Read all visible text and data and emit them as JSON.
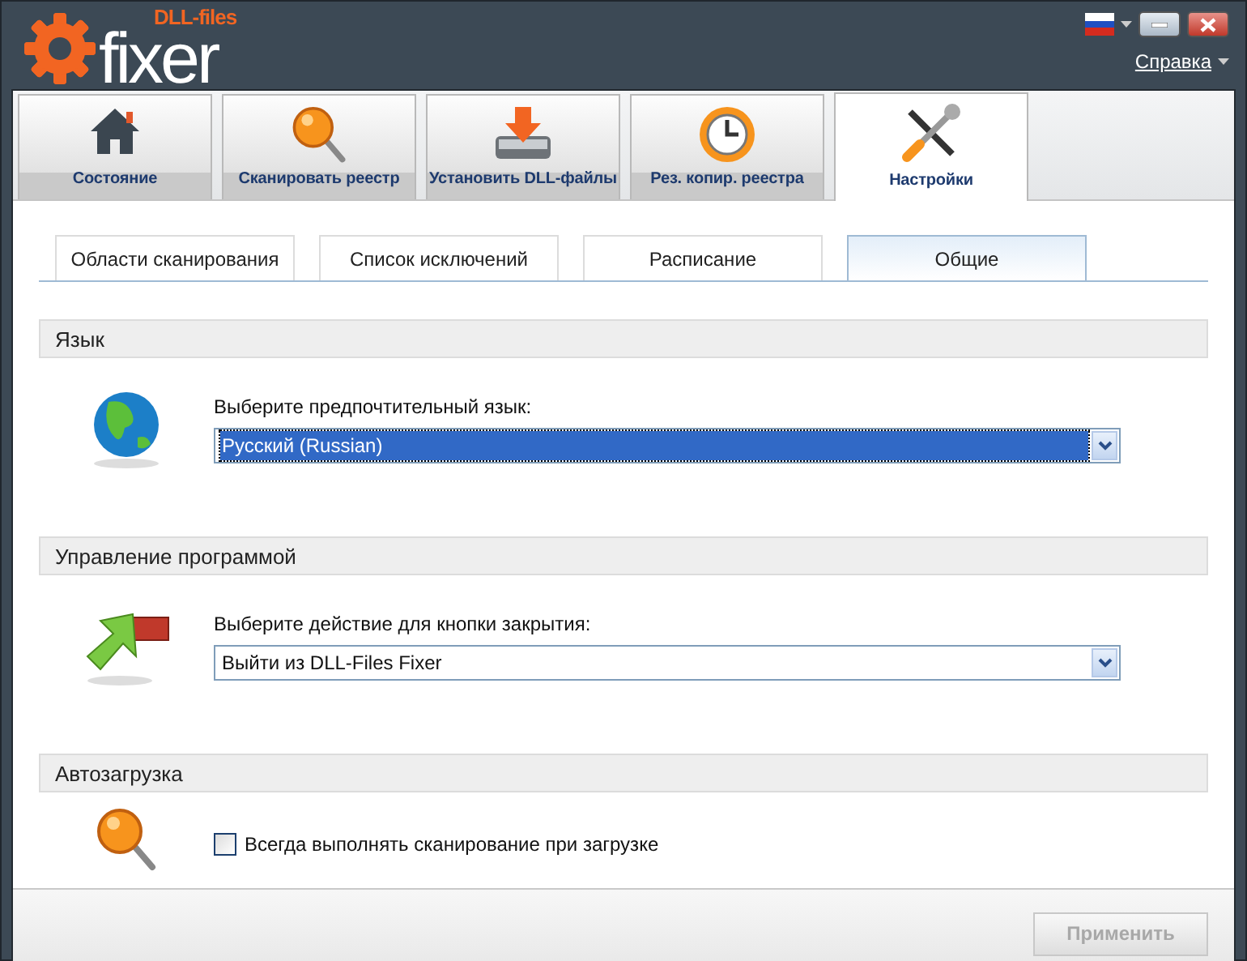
{
  "header": {
    "logo_small": "DLL-files",
    "logo_large": "fixer",
    "help_link": "Справка"
  },
  "main_tabs": [
    {
      "label": "Состояние",
      "selected": false
    },
    {
      "label": "Сканировать реестр",
      "selected": false
    },
    {
      "label": "Установить DLL-файлы",
      "selected": false
    },
    {
      "label": "Рез. копир. реестра",
      "selected": false
    },
    {
      "label": "Настройки",
      "selected": true
    }
  ],
  "sub_tabs": [
    {
      "label": "Области сканирования",
      "selected": false
    },
    {
      "label": "Список исключений",
      "selected": false
    },
    {
      "label": "Расписание",
      "selected": false
    },
    {
      "label": "Общие",
      "selected": true
    }
  ],
  "sections": [
    {
      "title": "Язык",
      "kind": "select",
      "label": "Выберите предпочтительный язык:",
      "value": "Русский (Russian)",
      "focused": true
    },
    {
      "title": "Управление программой",
      "kind": "select",
      "label": "Выберите действие для кнопки закрытия:",
      "value": "Выйти из DLL-Files Fixer",
      "focused": false
    },
    {
      "title": "Автозагрузка",
      "kind": "checkbox",
      "label": "Всегда выполнять сканирование при загрузке",
      "checked": false
    }
  ],
  "apply_button": {
    "label": "Применить",
    "disabled": true
  }
}
